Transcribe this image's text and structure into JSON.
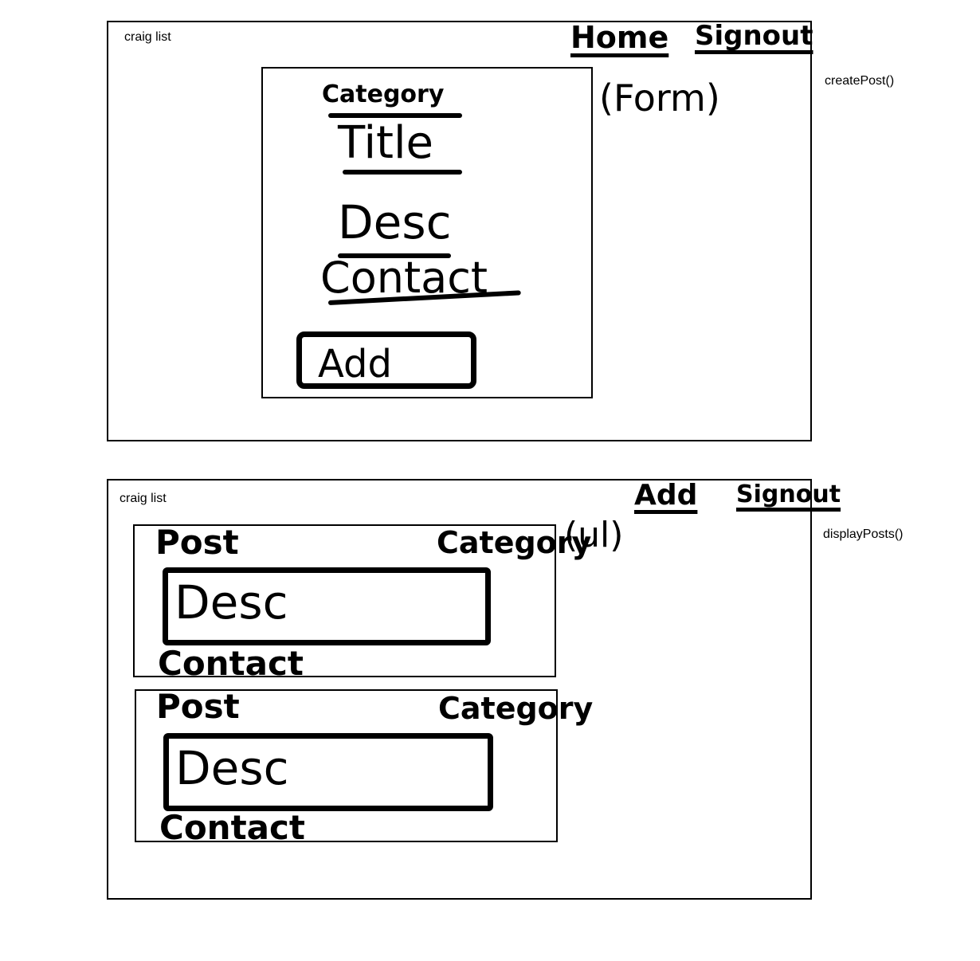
{
  "screen1": {
    "logo": "craig list",
    "nav": {
      "home": "Home",
      "signout": "Signout"
    },
    "form_note": "(Form)",
    "function_label": "createPost()",
    "form": {
      "category": "Category",
      "title": "Title",
      "desc": "Desc",
      "contact": "Contact",
      "add_button": "Add"
    }
  },
  "screen2": {
    "logo": "craig list",
    "nav": {
      "add": "Add",
      "signout": "Signout"
    },
    "list_note": "(ul)",
    "function_label": "displayPosts()",
    "posts": [
      {
        "post": "Post",
        "category": "Category",
        "desc": "Desc",
        "contact": "Contact"
      },
      {
        "post": "Post",
        "category": "Category",
        "desc": "Desc",
        "contact": "Contact"
      }
    ]
  }
}
